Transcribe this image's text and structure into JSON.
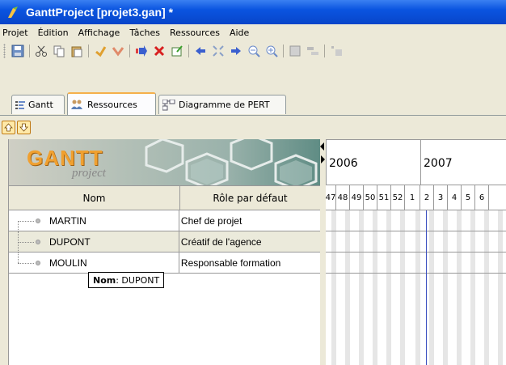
{
  "window": {
    "title": "GanttProject [projet3.gan] *"
  },
  "menu": [
    "Projet",
    "Édition",
    "Affichage",
    "Tâches",
    "Ressources",
    "Aide"
  ],
  "tabs": [
    {
      "label": "Gantt",
      "icon": "gantt-icon",
      "active": false
    },
    {
      "label": "Ressources",
      "icon": "resources-icon",
      "active": true
    },
    {
      "label": "Diagramme de PERT",
      "icon": "pert-icon",
      "active": false
    }
  ],
  "banner": {
    "logo_main": "GANTT",
    "logo_sub": "project"
  },
  "table": {
    "columns": [
      "Nom",
      "Rôle par défaut"
    ],
    "rows": [
      {
        "name": "MARTIN",
        "role": "Chef de projet"
      },
      {
        "name": "DUPONT",
        "role": "Créatif de l'agence"
      },
      {
        "name": "MOULIN",
        "role": "Responsable formation"
      }
    ]
  },
  "tooltip": {
    "label": "Nom",
    "value": " : DUPONT"
  },
  "chart": {
    "years": [
      "2006",
      "2007"
    ],
    "weeks": [
      "47",
      "48",
      "49",
      "50",
      "51",
      "52",
      "1",
      "2",
      "3",
      "4",
      "5",
      "6"
    ]
  },
  "colors": {
    "titlebar": "#0a54e0",
    "today_line": "#3b4fc0",
    "tab_highlight": "#f5b04b"
  }
}
